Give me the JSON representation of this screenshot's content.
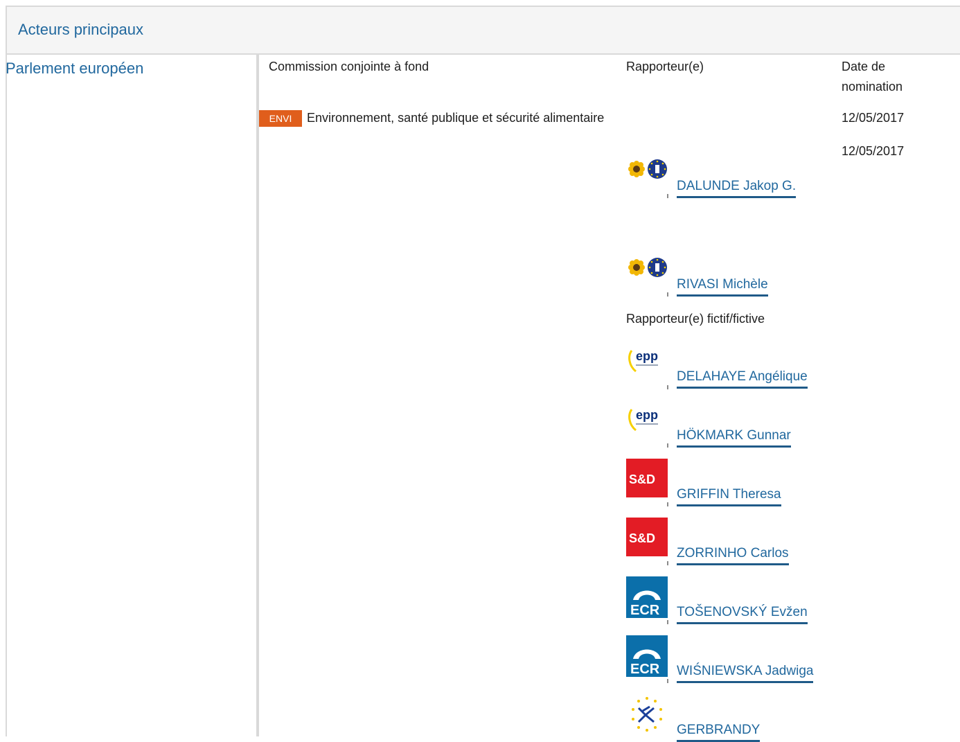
{
  "section": {
    "title": "Acteurs principaux"
  },
  "institution": "Parlement européen",
  "columns": {
    "committee": "Commission conjointe à fond",
    "rapporteur": "Rapporteur(e)",
    "date": "Date de nomination"
  },
  "committee": {
    "code": "ENVI",
    "name": "Environnement, santé publique et sécurité alimentaire"
  },
  "dates": [
    "12/05/2017",
    "12/05/2017"
  ],
  "rapporteurs": [
    {
      "name": "DALUNDE Jakop G.",
      "group": "greens-efa"
    },
    {
      "name": "RIVASI Michèle",
      "group": "greens-efa"
    }
  ],
  "shadow_label": "Rapporteur(e) fictif/fictive",
  "shadows": [
    {
      "name": "DELAHAYE Angélique",
      "group": "epp"
    },
    {
      "name": "HÖKMARK Gunnar",
      "group": "epp"
    },
    {
      "name": "GRIFFIN Theresa",
      "group": "sd"
    },
    {
      "name": "ZORRINHO Carlos",
      "group": "sd"
    },
    {
      "name": "TOŠENOVSKÝ Evžen",
      "group": "ecr"
    },
    {
      "name": "WIŚNIEWSKA Jadwiga",
      "group": "ecr"
    },
    {
      "name": "GERBRANDY",
      "group": "alde"
    }
  ],
  "logos": {
    "epp": "epp",
    "sd": "S&D",
    "ecr": "ECR"
  },
  "colors": {
    "link": "#21689e",
    "badge": "#e05e1c",
    "sd": "#e31c25",
    "ecr": "#0b6faa"
  }
}
